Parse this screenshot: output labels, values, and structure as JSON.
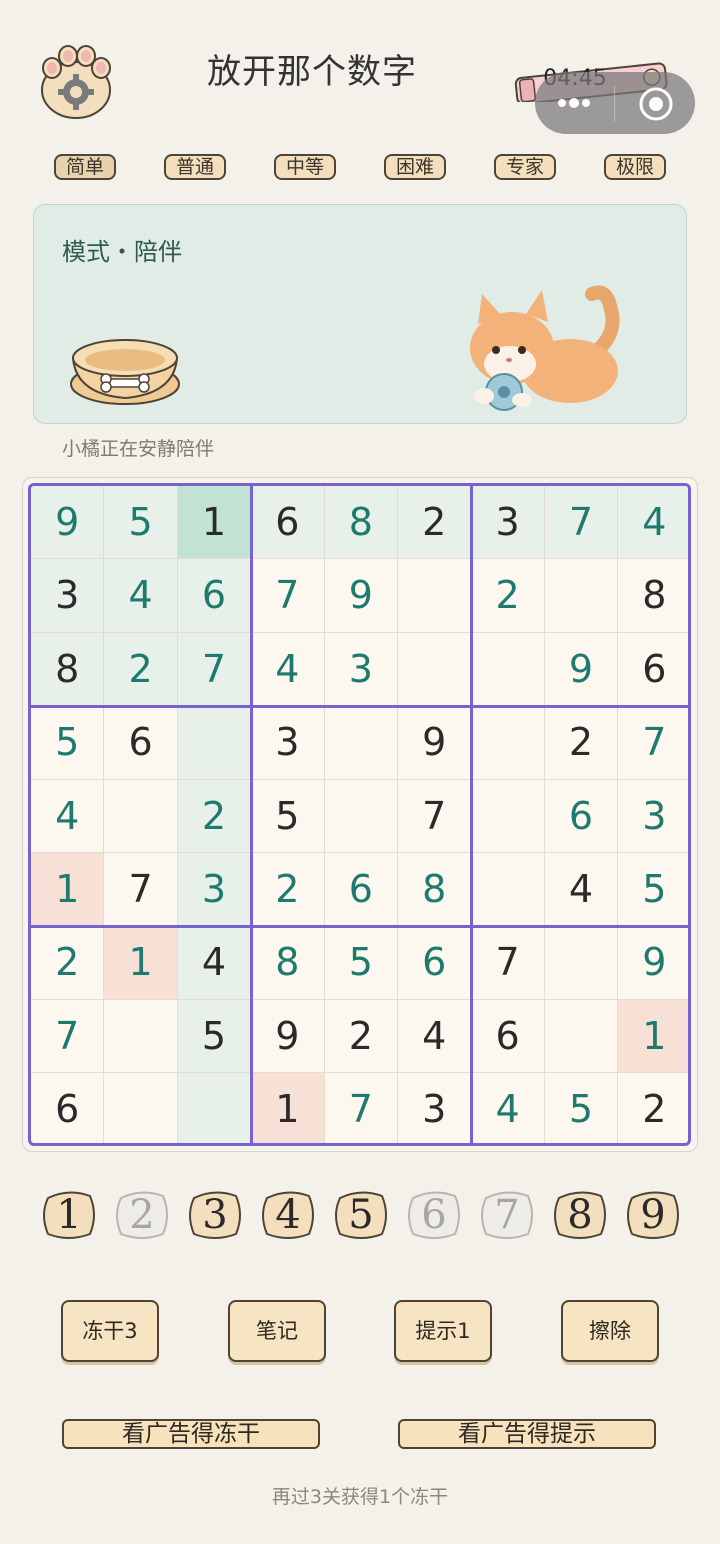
{
  "header": {
    "title": "放开那个数字",
    "timer": "04:45"
  },
  "difficulty_tabs": [
    {
      "label": "简单",
      "active": true
    },
    {
      "label": "普通",
      "active": false
    },
    {
      "label": "中等",
      "active": false
    },
    {
      "label": "困难",
      "active": false
    },
    {
      "label": "专家",
      "active": false
    },
    {
      "label": "极限",
      "active": false
    }
  ],
  "mode": {
    "label": "模式・陪伴",
    "companion_status": "小橘正在安静陪伴"
  },
  "board": {
    "rows": [
      [
        "9",
        "5",
        "1",
        "6",
        "8",
        "2",
        "3",
        "7",
        "4"
      ],
      [
        "3",
        "4",
        "6",
        "7",
        "9",
        "",
        "2",
        "",
        "8"
      ],
      [
        "8",
        "2",
        "7",
        "4",
        "3",
        "",
        "",
        "9",
        "6"
      ],
      [
        "5",
        "6",
        "",
        "3",
        "",
        "9",
        "",
        "2",
        "7"
      ],
      [
        "4",
        "",
        "2",
        "5",
        "",
        "7",
        "",
        "6",
        "3"
      ],
      [
        "1",
        "7",
        "3",
        "2",
        "6",
        "8",
        "",
        "4",
        "5"
      ],
      [
        "2",
        "1",
        "4",
        "8",
        "5",
        "6",
        "7",
        "",
        "9"
      ],
      [
        "7",
        "",
        "5",
        "9",
        "2",
        "4",
        "6",
        "",
        "1"
      ],
      [
        "6",
        "",
        "",
        "1",
        "7",
        "3",
        "4",
        "5",
        "2"
      ]
    ],
    "kinds": [
      [
        "u",
        "u",
        "g",
        "g",
        "u",
        "g",
        "g",
        "u",
        "u"
      ],
      [
        "g",
        "u",
        "u",
        "u",
        "u",
        "",
        "u",
        "",
        "g"
      ],
      [
        "g",
        "u",
        "u",
        "u",
        "u",
        "",
        "",
        "u",
        "g"
      ],
      [
        "u",
        "g",
        "",
        "g",
        "",
        "g",
        "",
        "g",
        "u"
      ],
      [
        "u",
        "",
        "u",
        "g",
        "",
        "g",
        "",
        "u",
        "u"
      ],
      [
        "u",
        "g",
        "u",
        "u",
        "u",
        "u",
        "",
        "g",
        "u"
      ],
      [
        "u",
        "u",
        "g",
        "u",
        "u",
        "u",
        "g",
        "",
        "u"
      ],
      [
        "u",
        "",
        "g",
        "g",
        "g",
        "g",
        "g",
        "",
        "u"
      ],
      [
        "g",
        "",
        "",
        "g",
        "u",
        "g",
        "u",
        "u",
        "g"
      ]
    ],
    "selected": [
      0,
      2
    ],
    "conflicts": [
      [
        5,
        0
      ],
      [
        6,
        1
      ],
      [
        7,
        8
      ],
      [
        8,
        3
      ]
    ]
  },
  "number_pad": [
    {
      "digit": "1",
      "available": true
    },
    {
      "digit": "2",
      "available": false
    },
    {
      "digit": "3",
      "available": true
    },
    {
      "digit": "4",
      "available": true
    },
    {
      "digit": "5",
      "available": true
    },
    {
      "digit": "6",
      "available": false
    },
    {
      "digit": "7",
      "available": false
    },
    {
      "digit": "8",
      "available": true
    },
    {
      "digit": "9",
      "available": true
    }
  ],
  "actions": {
    "freeze": "冻干3",
    "notes": "笔记",
    "hint": "提示1",
    "erase": "擦除"
  },
  "ads": {
    "freeze": "看广告得冻干",
    "hint": "看广告得提示"
  },
  "footer": "再过3关获得1个冻干",
  "colors": {
    "grid_border": "#7663cf",
    "user_digit": "#1e7a6e",
    "highlight": "#e7f1ea",
    "selected": "#c2e2d3",
    "conflict": "#f7e1d6"
  }
}
